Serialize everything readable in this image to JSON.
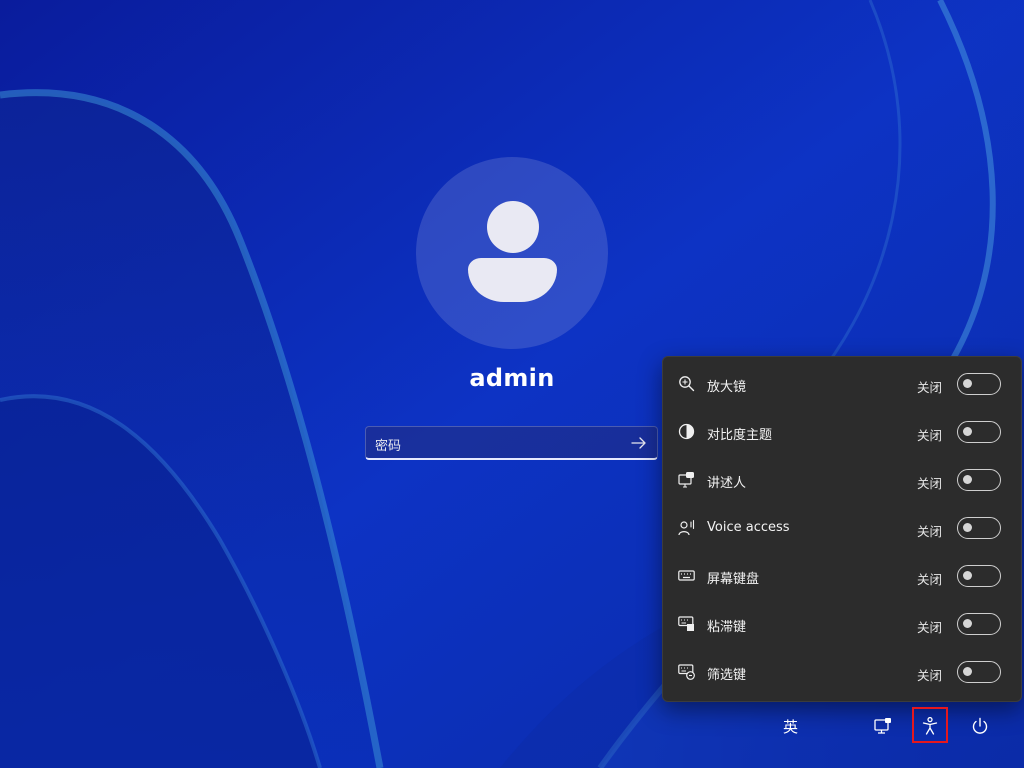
{
  "login": {
    "username": "admin",
    "password_placeholder": "密码"
  },
  "accessibility_flyout": {
    "items": [
      {
        "label": "放大镜",
        "state": "关闭",
        "icon": "magnifier-icon",
        "on": false
      },
      {
        "label": "对比度主题",
        "state": "关闭",
        "icon": "contrast-icon",
        "on": false
      },
      {
        "label": "讲述人",
        "state": "关闭",
        "icon": "narrator-icon",
        "on": false
      },
      {
        "label": "Voice access",
        "state": "关闭",
        "icon": "voice-access-icon",
        "on": false
      },
      {
        "label": "屏幕键盘",
        "state": "关闭",
        "icon": "keyboard-icon",
        "on": false
      },
      {
        "label": "粘滞键",
        "state": "关闭",
        "icon": "sticky-keys-icon",
        "on": false
      },
      {
        "label": "筛选键",
        "state": "关闭",
        "icon": "filter-keys-icon",
        "on": false
      }
    ]
  },
  "bottom_bar": {
    "input_method": "英",
    "icons": [
      "network-icon",
      "accessibility-icon",
      "power-icon"
    ]
  },
  "colors": {
    "wallpaper": "#0b2bb8",
    "flyout_bg": "#2c2c2c",
    "highlight_border": "#e5181e"
  }
}
